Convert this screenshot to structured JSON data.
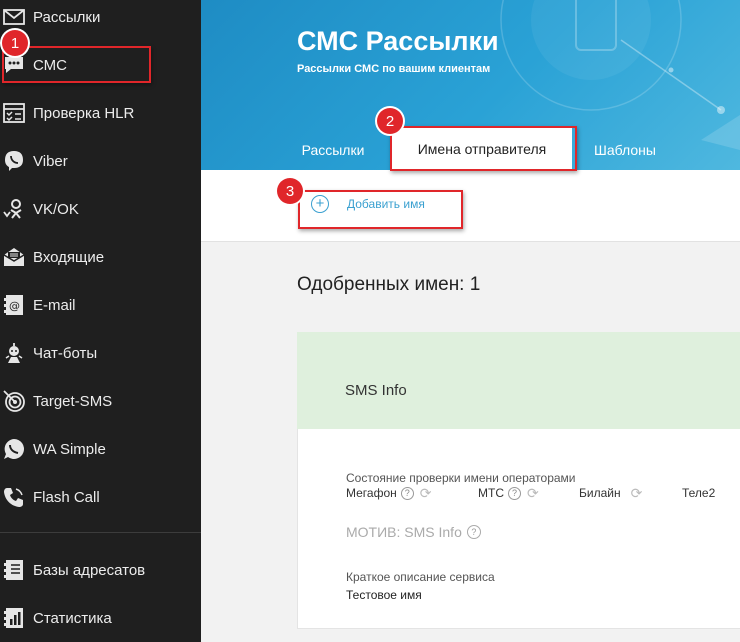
{
  "sidebar": {
    "items": [
      {
        "label": "Рассылки",
        "icon": "envelope-icon"
      },
      {
        "label": "СМС",
        "icon": "chat-bubble-icon"
      },
      {
        "label": "Проверка HLR",
        "icon": "checklist-icon"
      },
      {
        "label": "Viber",
        "icon": "viber-icon"
      },
      {
        "label": "VK/OK",
        "icon": "vk-ok-icon"
      },
      {
        "label": "Входящие",
        "icon": "inbox-icon"
      },
      {
        "label": "E-mail",
        "icon": "email-at-icon"
      },
      {
        "label": "Чат-боты",
        "icon": "robot-icon"
      },
      {
        "label": "Target-SMS",
        "icon": "target-icon"
      },
      {
        "label": "WA Simple",
        "icon": "whatsapp-icon"
      },
      {
        "label": "Flash Call",
        "icon": "phone-icon"
      },
      {
        "label": "Базы адресатов",
        "icon": "address-list-icon"
      },
      {
        "label": "Статистика",
        "icon": "bar-chart-icon"
      }
    ]
  },
  "header": {
    "title": "СМС Рассылки",
    "subtitle": "Рассылки СМС по вашим клиентам",
    "tabs": [
      "Рассылки",
      "Имена отправителя",
      "Шаблоны"
    ]
  },
  "toolbar": {
    "add_label": "Добавить имя"
  },
  "content": {
    "approved_title": "Одобренных имен: 1",
    "card": {
      "name": "SMS Info",
      "status_title": "Состояние проверки имени операторами",
      "operators": [
        "Мегафон",
        "МТС",
        "Билайн",
        "Теле2"
      ],
      "motiv": "МОТИВ: SMS Info",
      "desc_label": "Краткое описание сервиса",
      "desc_value": "Тестовое имя"
    }
  },
  "annotations": [
    "1",
    "2",
    "3"
  ],
  "colors": {
    "accent": "#2aa2d6",
    "highlight": "#e0262a",
    "approved_bg": "#dff0dd",
    "sidebar_bg": "#1f1f1f"
  }
}
